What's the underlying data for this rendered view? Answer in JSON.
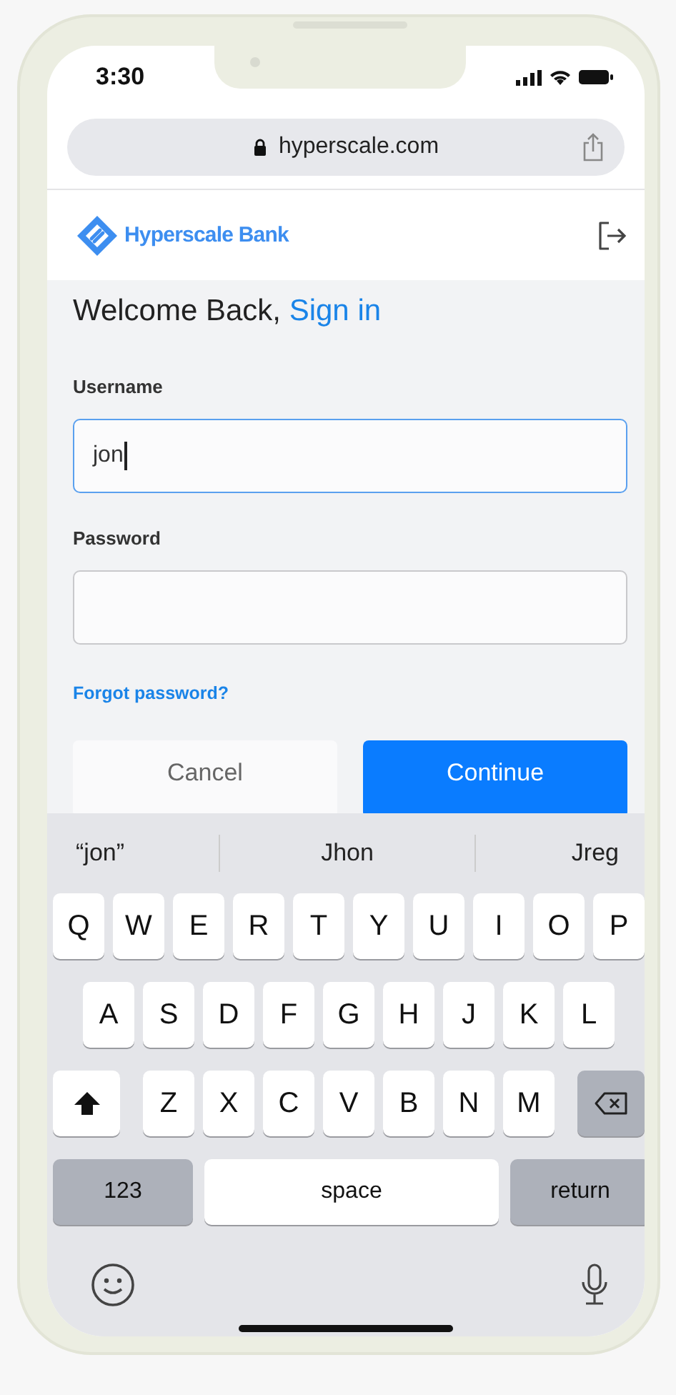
{
  "status_bar": {
    "time": "3:30"
  },
  "address_bar": {
    "url": "hyperscale.com"
  },
  "header": {
    "brand": "Hyperscale Bank"
  },
  "heading": {
    "text": "Welcome Back,",
    "link": "Sign in"
  },
  "fields": [
    {
      "label": "Username",
      "value": "jon",
      "focused": true
    },
    {
      "label": "Password",
      "focused": false
    }
  ],
  "forgot_link": "Forgot password?",
  "buttons": [
    {
      "label": "Cancel",
      "kind": "secondary"
    },
    {
      "label": "Continue",
      "kind": "primary"
    }
  ],
  "suggestions": [
    "“jon”",
    "Jhon",
    "Jreg"
  ],
  "keyboard": {
    "rows": [
      {
        "keys": [
          {
            "kind": "letter",
            "label": "Q"
          },
          {
            "kind": "letter",
            "label": "W"
          },
          {
            "kind": "letter",
            "label": "E"
          },
          {
            "kind": "letter",
            "label": "R"
          },
          {
            "kind": "letter",
            "label": "T"
          },
          {
            "kind": "letter",
            "label": "Y"
          },
          {
            "kind": "letter",
            "label": "U"
          },
          {
            "kind": "letter",
            "label": "I"
          },
          {
            "kind": "letter",
            "label": "O"
          },
          {
            "kind": "letter",
            "label": "P"
          }
        ]
      },
      {
        "keys": [
          {
            "kind": "letter",
            "label": "A"
          },
          {
            "kind": "letter",
            "label": "S"
          },
          {
            "kind": "letter",
            "label": "D"
          },
          {
            "kind": "letter",
            "label": "F"
          },
          {
            "kind": "letter",
            "label": "G"
          },
          {
            "kind": "letter",
            "label": "H"
          },
          {
            "kind": "letter",
            "label": "J"
          },
          {
            "kind": "letter",
            "label": "K"
          },
          {
            "kind": "letter",
            "label": "L"
          }
        ]
      },
      {
        "keys": [
          {
            "kind": "shift"
          },
          {
            "kind": "letter",
            "label": "Z"
          },
          {
            "kind": "letter",
            "label": "X"
          },
          {
            "kind": "letter",
            "label": "C"
          },
          {
            "kind": "letter",
            "label": "V"
          },
          {
            "kind": "letter",
            "label": "B"
          },
          {
            "kind": "letter",
            "label": "N"
          },
          {
            "kind": "letter",
            "label": "M"
          },
          {
            "kind": "backspace"
          }
        ]
      },
      {
        "keys": [
          {
            "kind": "mode",
            "label": "123"
          },
          {
            "kind": "space",
            "label": "space"
          },
          {
            "kind": "return",
            "label": "return"
          }
        ]
      }
    ]
  }
}
